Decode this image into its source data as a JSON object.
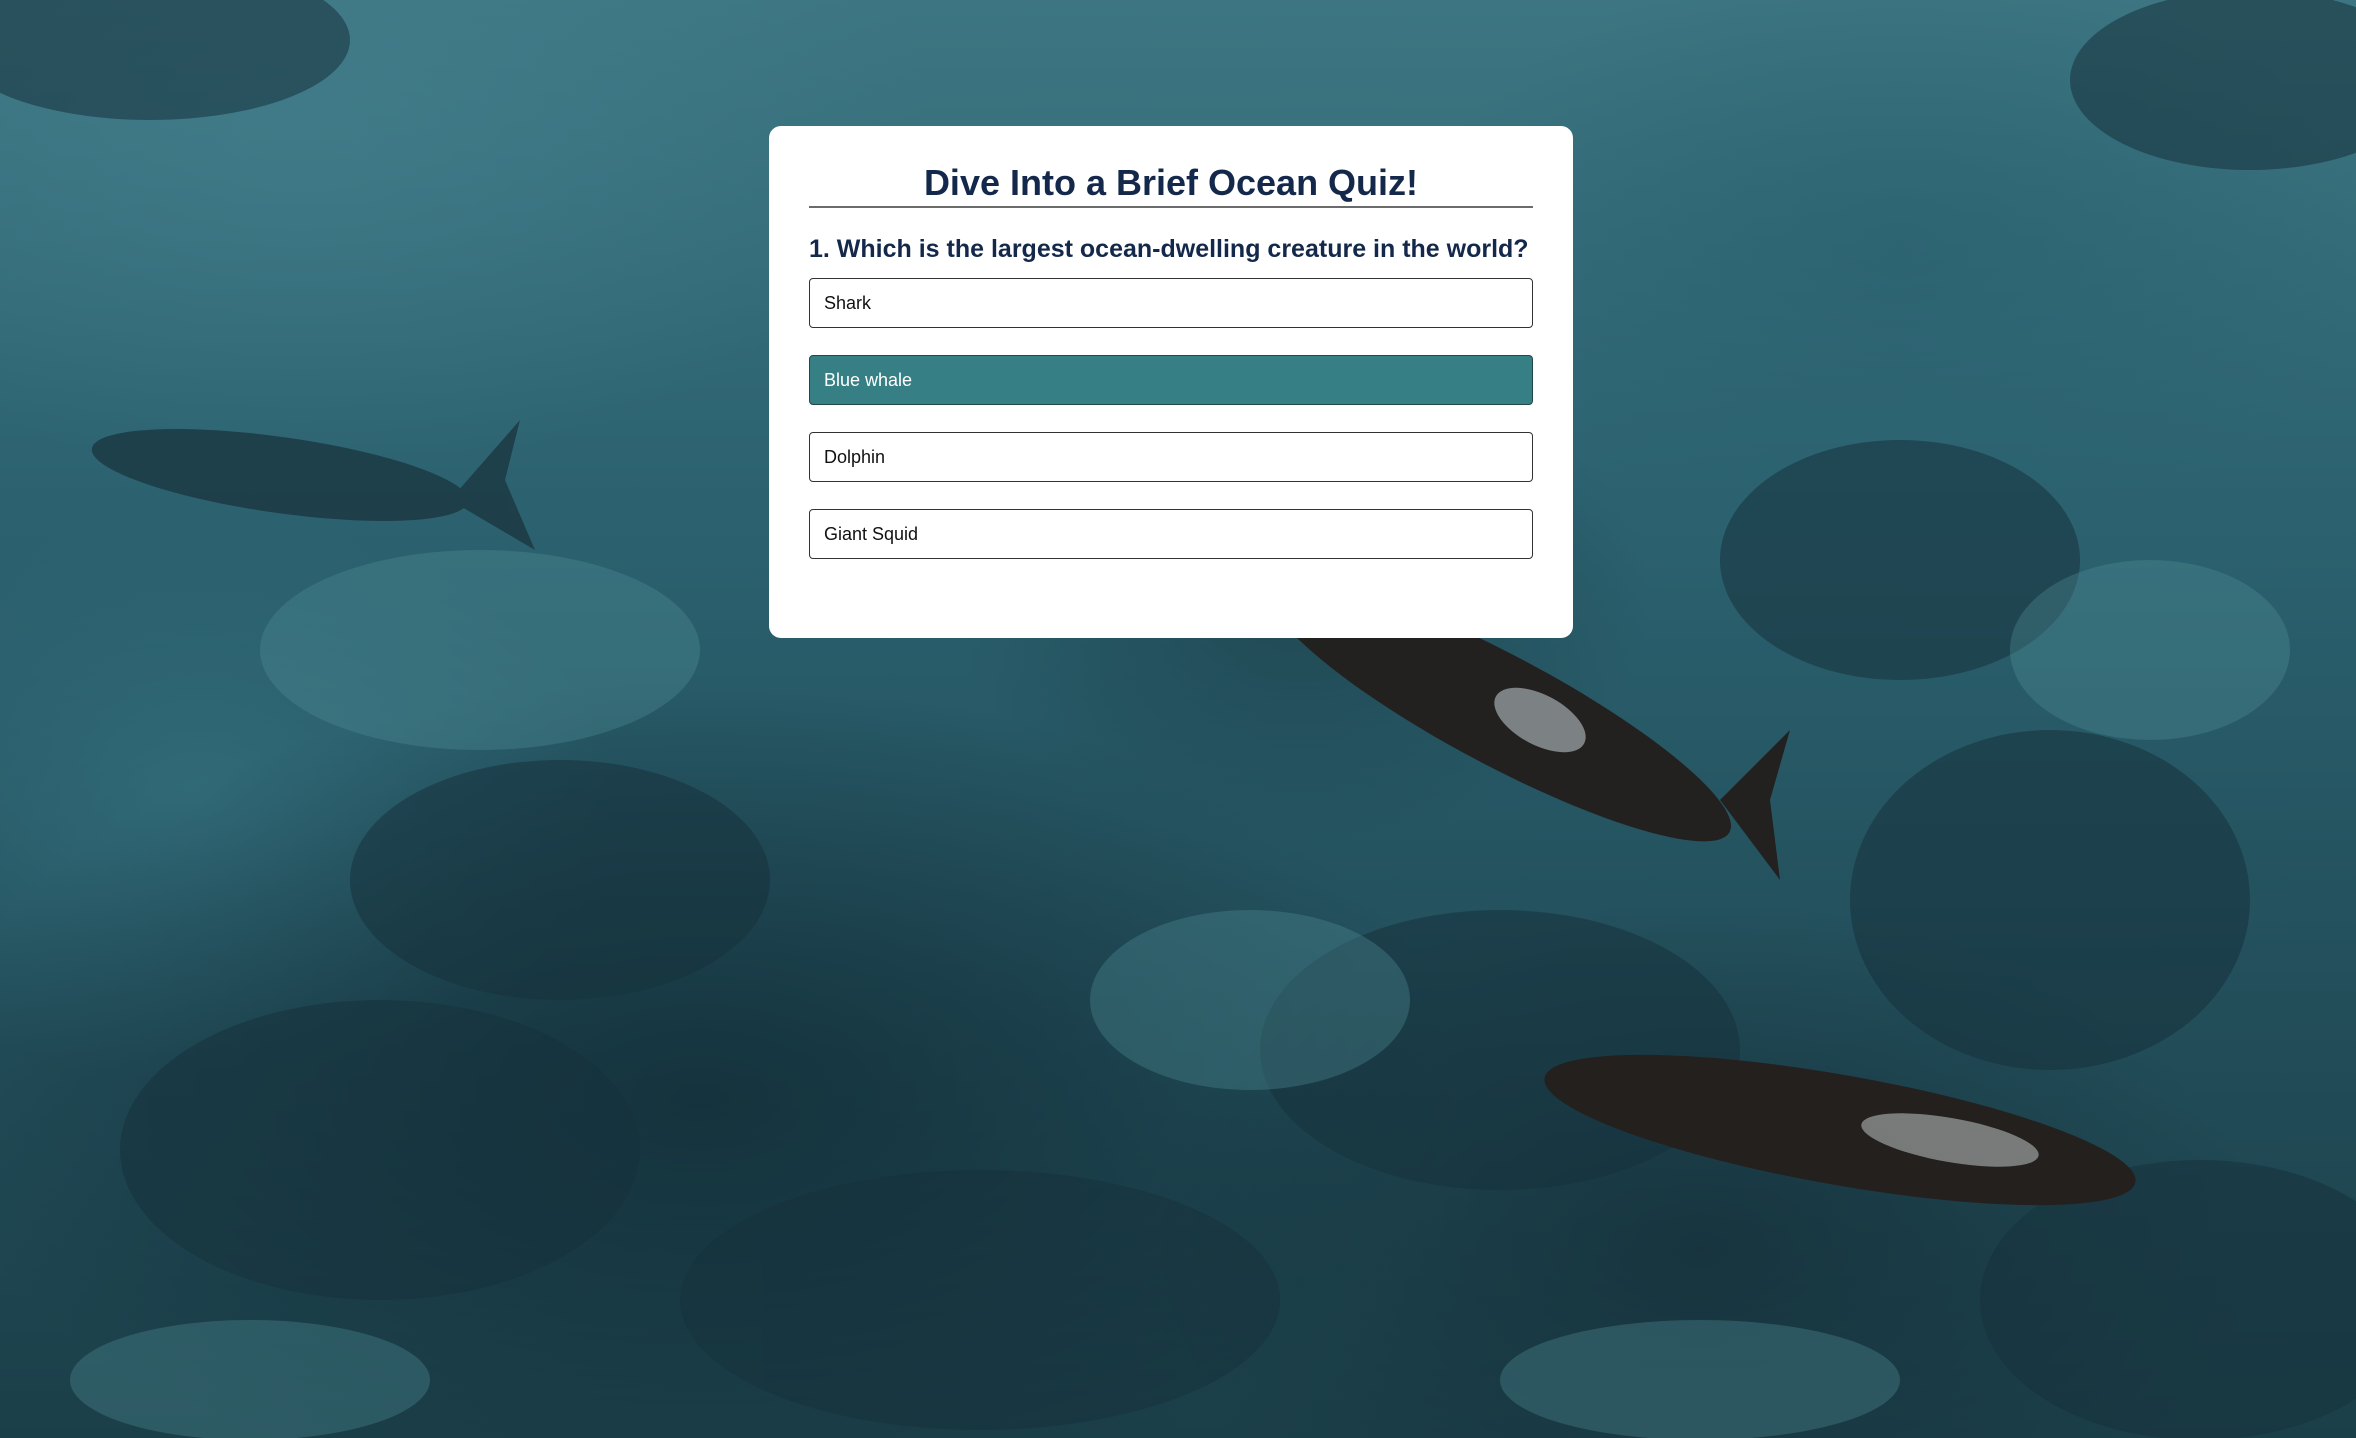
{
  "quiz": {
    "title": "Dive Into a Brief Ocean Quiz!",
    "question": "1. Which is the largest ocean-dwelling creature in the world?",
    "options": [
      {
        "label": "Shark",
        "selected": false
      },
      {
        "label": "Blue whale",
        "selected": true
      },
      {
        "label": "Dolphin",
        "selected": false
      },
      {
        "label": "Giant Squid",
        "selected": false
      }
    ]
  },
  "colors": {
    "card_background": "#ffffff",
    "title_text": "#13284a",
    "selected_option": "#367f85",
    "ocean": "#2c6270"
  },
  "background_image": "aerial-ocean-whales-photo"
}
